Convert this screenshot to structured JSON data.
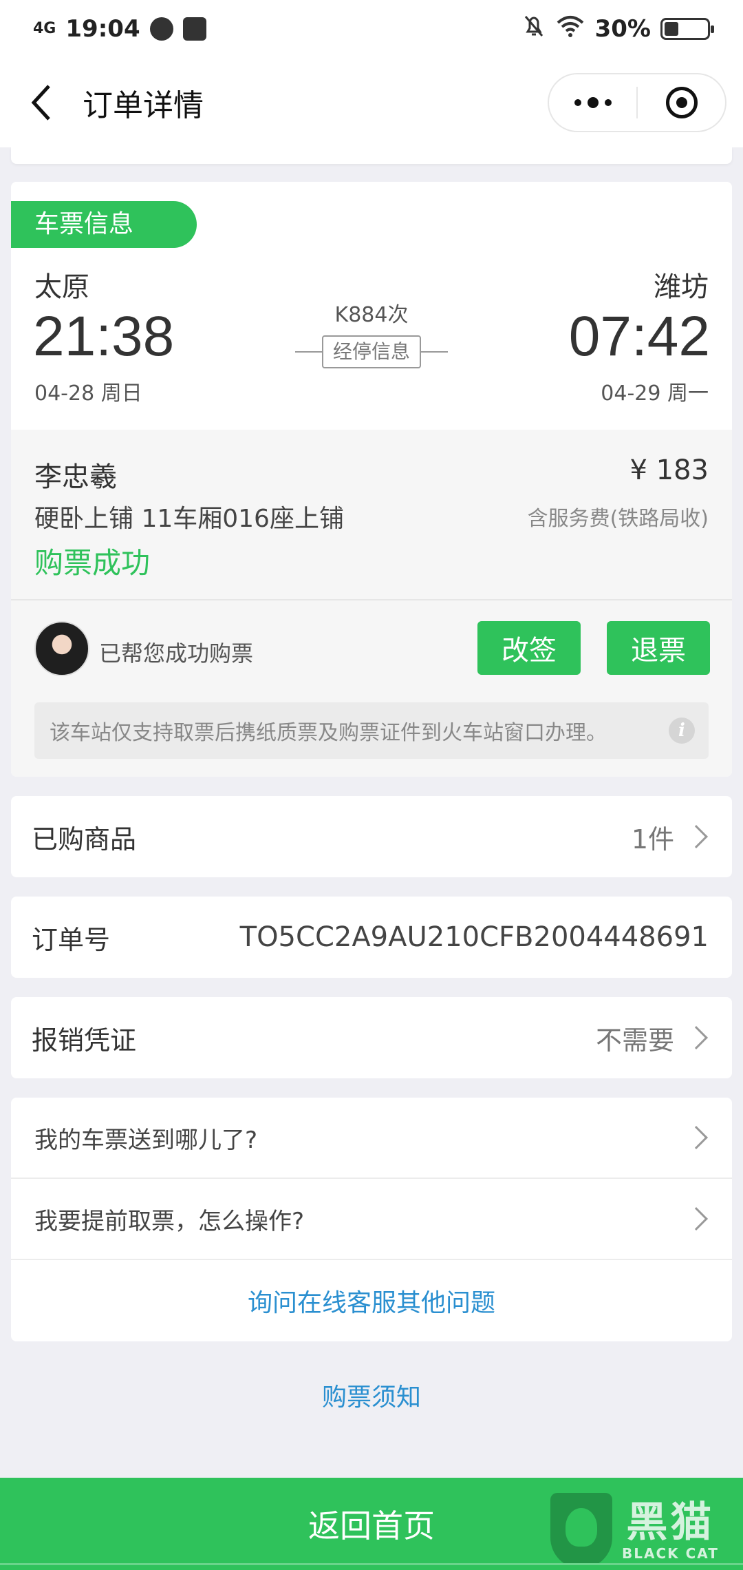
{
  "status_bar": {
    "network": "4G",
    "time": "19:04",
    "battery": "30%"
  },
  "nav": {
    "title": "订单详情"
  },
  "ticket": {
    "tag": "车票信息",
    "from_station": "太原",
    "from_time": "21:38",
    "from_date": "04-28 周日",
    "to_station": "潍坊",
    "to_time": "07:42",
    "to_date": "04-29 周一",
    "train_no": "K884次",
    "stops_label": "经停信息",
    "passenger": "李忠羲",
    "price": "¥ 183",
    "seat": "硬卧上铺 11车厢016座上铺",
    "fee_note": "含服务费(铁路局收)",
    "status": "购票成功",
    "helper": "已帮您成功购票",
    "change_label": "改签",
    "refund_label": "退票",
    "notice": "该车站仅支持取票后携纸质票及购票证件到火车站窗口办理。"
  },
  "rows": {
    "goods_label": "已购商品",
    "goods_value": "1件",
    "order_label": "订单号",
    "order_value": "TO5CC2A9AU210CFB2004448691",
    "invoice_label": "报销凭证",
    "invoice_value": "不需要"
  },
  "faq": {
    "q1": "我的车票送到哪儿了?",
    "q2": "我要提前取票，怎么操作?",
    "more": "询问在线客服其他问题"
  },
  "notice_link": "购票须知",
  "home_button": "返回首页",
  "watermark": {
    "cn": "黑猫",
    "en": "BLACK CAT"
  },
  "colors": {
    "accent": "#2fc25b",
    "link": "#2a8fd0"
  }
}
